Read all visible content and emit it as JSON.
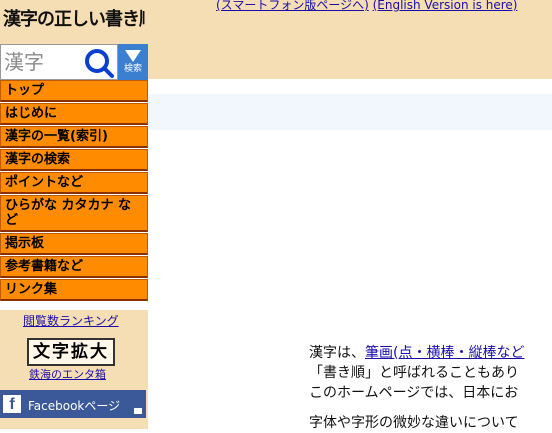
{
  "header": {
    "logo_text": "漢字の正しい書き順(筆順)",
    "links": [
      {
        "label": "(スマートフォン版ページへ)"
      },
      {
        "label": "(English Version is here)"
      }
    ]
  },
  "search": {
    "placeholder": "漢字",
    "button_label": "検索"
  },
  "menu": {
    "items": [
      {
        "label": "トップ"
      },
      {
        "label": "はじめに"
      },
      {
        "label": "漢字の一覧(索引)"
      },
      {
        "label": "漢字の検索"
      },
      {
        "label": "ポイントなど"
      },
      {
        "label": "ひらがな カタカナ など"
      },
      {
        "label": "掲示板"
      },
      {
        "label": "参考書籍など"
      },
      {
        "label": "リンク集"
      }
    ]
  },
  "extras": {
    "ranking_link": "閲覧数ランキング",
    "moji_button": "文字拡大",
    "tetsukai_link": "鉄海のエンタ箱",
    "facebook_label": "Facebookページ"
  },
  "content": {
    "line1_prefix": "漢字は、",
    "line1_link": "筆画(点・横棒・縦棒など",
    "line2": "「書き順」と呼ばれることもあり",
    "line3": "このホームページでは、日本にお",
    "line4": "字体や字形の微妙な違いについて"
  },
  "colors": {
    "header_bg": "#f5deb3",
    "menu_bg": "#ff8c00",
    "search_button_bg": "#3a7fd0",
    "facebook_bg": "#3b5998",
    "link": "#1a0dab"
  }
}
